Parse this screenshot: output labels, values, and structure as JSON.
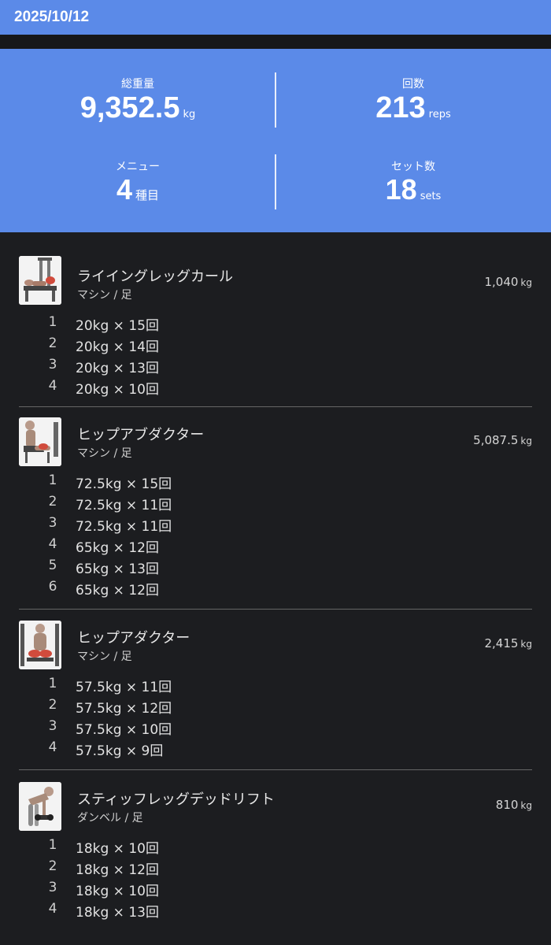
{
  "header": {
    "date": "2025/10/12"
  },
  "summary": {
    "total_weight": {
      "label": "総重量",
      "value": "9,352.5",
      "unit": "kg"
    },
    "reps": {
      "label": "回数",
      "value": "213",
      "unit": "reps"
    },
    "menu": {
      "label": "メニュー",
      "value": "4",
      "unit": "種目"
    },
    "sets": {
      "label": "セット数",
      "value": "18",
      "unit": "sets"
    }
  },
  "exercises": [
    {
      "name": "ライイングレッグカール",
      "category": "マシン / 足",
      "total": "1,040",
      "total_unit": "kg",
      "sets": [
        {
          "no": "1",
          "detail": "20kg × 15回"
        },
        {
          "no": "2",
          "detail": "20kg × 14回"
        },
        {
          "no": "3",
          "detail": "20kg × 13回"
        },
        {
          "no": "4",
          "detail": "20kg × 10回"
        }
      ]
    },
    {
      "name": "ヒップアブダクター",
      "category": "マシン / 足",
      "total": "5,087.5",
      "total_unit": "kg",
      "sets": [
        {
          "no": "1",
          "detail": "72.5kg × 15回"
        },
        {
          "no": "2",
          "detail": "72.5kg × 11回"
        },
        {
          "no": "3",
          "detail": "72.5kg × 11回"
        },
        {
          "no": "4",
          "detail": "65kg × 12回"
        },
        {
          "no": "5",
          "detail": "65kg × 13回"
        },
        {
          "no": "6",
          "detail": "65kg × 12回"
        }
      ]
    },
    {
      "name": "ヒップアダクター",
      "category": "マシン / 足",
      "total": "2,415",
      "total_unit": "kg",
      "sets": [
        {
          "no": "1",
          "detail": "57.5kg × 11回"
        },
        {
          "no": "2",
          "detail": "57.5kg × 12回"
        },
        {
          "no": "3",
          "detail": "57.5kg × 10回"
        },
        {
          "no": "4",
          "detail": "57.5kg × 9回"
        }
      ]
    },
    {
      "name": "スティッフレッグデッドリフト",
      "category": "ダンベル / 足",
      "total": "810",
      "total_unit": "kg",
      "sets": [
        {
          "no": "1",
          "detail": "18kg × 10回"
        },
        {
          "no": "2",
          "detail": "18kg × 12回"
        },
        {
          "no": "3",
          "detail": "18kg × 10回"
        },
        {
          "no": "4",
          "detail": "18kg × 13回"
        }
      ]
    }
  ]
}
